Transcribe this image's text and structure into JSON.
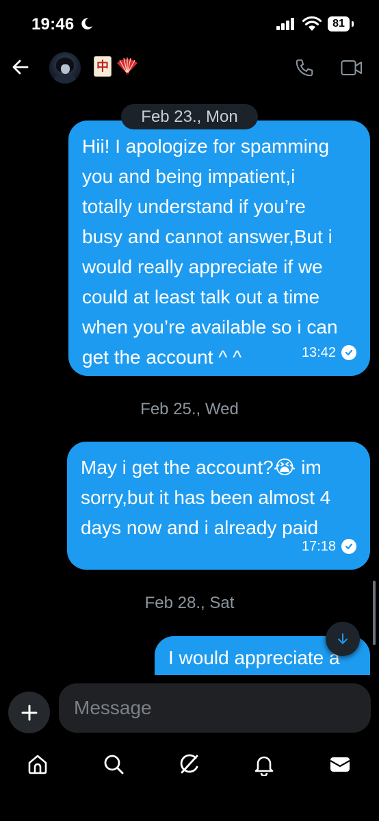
{
  "status": {
    "time": "19:46",
    "battery": "81"
  },
  "header": {
    "name_emojis": "🀄🪭",
    "tile_char": "中"
  },
  "messages": [
    {
      "date_pill": "Feb 23., Mon",
      "text": "Hii! I apologize for spamming\nyou and being impatient,i\ntotally understand if you’re\nbusy and cannot answer,But i\nwould really appreciate if we\ncould at least talk out a time\nwhen you’re available so i can\nget the account ^ ^",
      "time": "13:42"
    },
    {
      "date": "Feb 25., Wed",
      "text": "May i get the account?😭 im\nsorry,but it has been almost 4\ndays now and i already paid",
      "time": "17:18"
    },
    {
      "date": "Feb 28., Sat",
      "text": "I would appreciate a"
    }
  ],
  "composer": {
    "placeholder": "Message"
  },
  "colors": {
    "bubble": "#1d9bf0",
    "background": "#000000"
  },
  "tabs": [
    "home-icon",
    "search-icon",
    "grok-icon",
    "notifications-icon",
    "messages-icon"
  ]
}
